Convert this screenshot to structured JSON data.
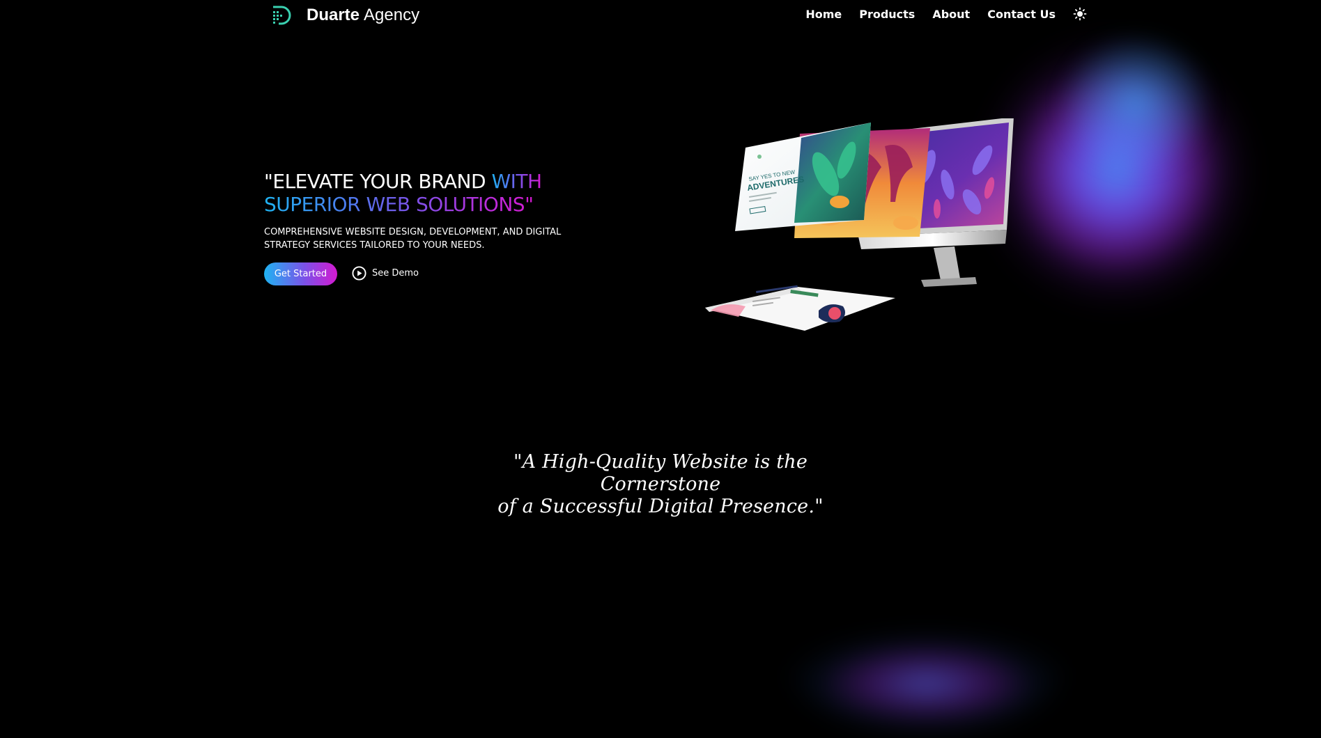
{
  "header": {
    "brand_bold": "Duarte",
    "brand_light": "Agency",
    "logo_icon": "logo-d-icon",
    "nav": [
      {
        "label": "Home"
      },
      {
        "label": "Products"
      },
      {
        "label": "About"
      },
      {
        "label": "Contact Us"
      }
    ],
    "theme_icon": "sun-icon"
  },
  "hero": {
    "title_plain": "\"ELEVATE YOUR BRAND ",
    "title_gradient_1": "WITH",
    "title_gradient_2": "SUPERIOR WEB SOLUTIONS\"",
    "subtitle": "COMPREHENSIVE WEBSITE DESIGN, DEVELOPMENT, AND DIGITAL STRATEGY SERVICES TAILORED TO YOUR NEEDS.",
    "primary_button": "Get Started",
    "secondary_button": "See Demo",
    "secondary_icon": "play-circle-icon",
    "mockup_text_1": "SAY YES TO NEW",
    "mockup_text_2": "ADVENTURES"
  },
  "quote": {
    "line1": "\"A High-Quality Website is the Cornerstone",
    "line2": "of a Successful Digital Presence.\""
  },
  "colors": {
    "background": "#000000",
    "gradient_start": "#1fb3f2",
    "gradient_mid": "#7b52e8",
    "gradient_end": "#d31ad0",
    "logo_teal": "#3ad0b0"
  }
}
